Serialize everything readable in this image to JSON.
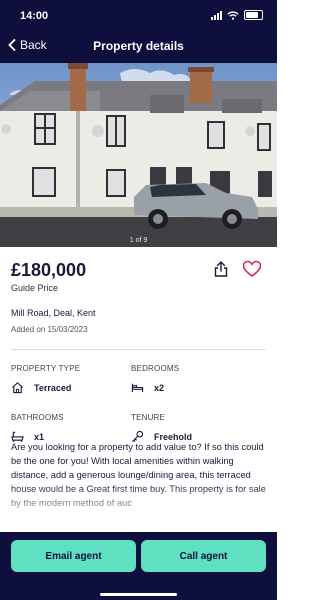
{
  "status_bar": {
    "time": "14:00"
  },
  "nav": {
    "back_label": "Back",
    "title": "Property details"
  },
  "gallery": {
    "counter": "1 of 9"
  },
  "listing": {
    "price": "£180,000",
    "price_qualifier": "Guide Price",
    "address": "Mill Road, Deal, Kent",
    "added": "Added on 15/03/2023",
    "favourite_color": "#d8264a"
  },
  "specs": {
    "property_type": {
      "label": "PROPERTY TYPE",
      "value": "Terraced",
      "icon": "house-icon"
    },
    "bedrooms": {
      "label": "BEDROOMS",
      "value": "x2",
      "icon": "bed-icon"
    },
    "bathrooms": {
      "label": "BATHROOMS",
      "value": "x1",
      "icon": "bath-icon"
    },
    "tenure": {
      "label": "TENURE",
      "value": "Freehold",
      "icon": "key-icon"
    }
  },
  "description": {
    "text": "Are you looking for a property to add value to? If so this could be the one for you! With local amenities within walking distance, add a generous lounge/dining area, this terraced house would be a Great first time buy. This property is for sale by the modern method of auc"
  },
  "actions": {
    "email_label": "Email agent",
    "call_label": "Call agent",
    "accent": "#5fe0c0",
    "brand": "#0e0f3d"
  }
}
